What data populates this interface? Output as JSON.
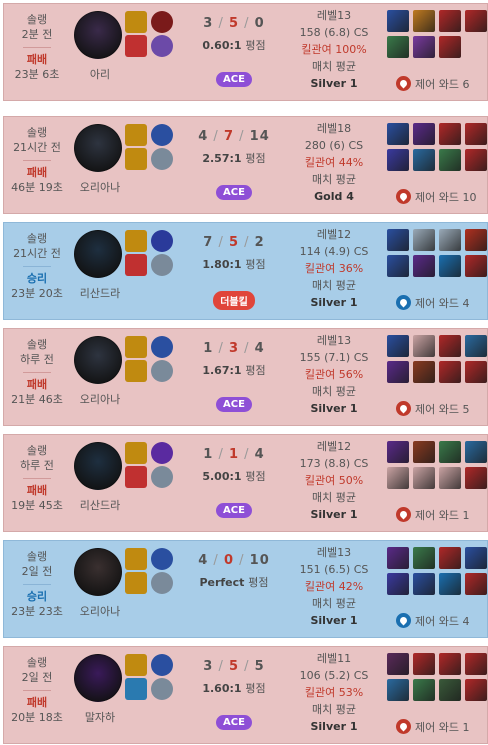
{
  "unit_ratio": "평점",
  "ward_prefix": "제어 와드",
  "cs_suffix": "CS",
  "kp_prefix": "킬관여",
  "avg_label": "매치 평균",
  "level_prefix": "레벨",
  "colors": {
    "loss_bg": "#e8c3c3",
    "win_bg": "#a8cde8",
    "loss_text": "#c0392b",
    "win_text": "#1a6fb0",
    "ace": "#8e4fd6",
    "double_kill": "#e0453a"
  },
  "matches": [
    {
      "queue": "솔랭",
      "ago": "2분 전",
      "result": "패배",
      "duration": "23분 6초",
      "champion": "아리",
      "champ_icon": "ari-portrait-icon",
      "champ_color": "#3a2a4a",
      "spells": [
        "#c08a10",
        "#c03030"
      ],
      "runes": [
        "#7a1a1a",
        "#6c4aa8"
      ],
      "kills": "3",
      "deaths": "5",
      "assists": "0",
      "ratio": "0.60:1",
      "badge": "ACE",
      "badge_type": "ace",
      "level": "레벨13",
      "cs": "158 (6.8) CS",
      "kp": "킬관여 100%",
      "avg": "매치 평균",
      "tier": "Silver 1",
      "items": [
        "#2a4fa0",
        "#c07a20",
        "#b02828",
        "#b02828",
        "#3a7a4a",
        "#7a3aa0",
        "#b02828",
        ""
      ],
      "ward": "제어 와드 6"
    },
    {
      "queue": "솔랭",
      "ago": "21시간 전",
      "result": "패배",
      "duration": "46분 19초",
      "champion": "오리아나",
      "champ_icon": "orianna-portrait-icon",
      "champ_color": "#2e3440",
      "spells": [
        "#c08a10",
        "#c08a10"
      ],
      "runes": [
        "#2a4fa0",
        "#7a8a9a"
      ],
      "kills": "4",
      "deaths": "7",
      "assists": "14",
      "ratio": "2.57:1",
      "badge": "ACE",
      "badge_type": "ace",
      "level": "레벨18",
      "cs": "280 (6) CS",
      "kp": "킬관여 44%",
      "avg": "매치 평균",
      "tier": "Gold 4",
      "items": [
        "#2a4fa0",
        "#5a2a8a",
        "#b02828",
        "#b02828",
        "#3a3aa0",
        "#2a6aa0",
        "#3a7a4a",
        "#b02828"
      ],
      "ward": "제어 와드 10"
    },
    {
      "queue": "솔랭",
      "ago": "21시간 전",
      "result": "승리",
      "duration": "23분 20초",
      "champion": "리산드라",
      "champ_icon": "lissandra-portrait-icon",
      "champ_color": "#1e2f40",
      "spells": [
        "#c08a10",
        "#c03030"
      ],
      "runes": [
        "#2a3a9a",
        "#7a8a9a"
      ],
      "kills": "7",
      "deaths": "5",
      "assists": "2",
      "ratio": "1.80:1",
      "badge": "더블킬",
      "badge_type": "double",
      "level": "레벨12",
      "cs": "114 (4.9) CS",
      "kp": "킬관여 36%",
      "avg": "매치 평균",
      "tier": "Silver 1",
      "items": [
        "#2a4fa0",
        "#9aaab8",
        "#9aaab8",
        "#b03020",
        "#2a4fa0",
        "#5a2a8a",
        "#1a6fb0",
        "#b02828"
      ],
      "ward": "제어 와드 4"
    },
    {
      "queue": "솔랭",
      "ago": "하루 전",
      "result": "패배",
      "duration": "21분 46초",
      "champion": "오리아나",
      "champ_icon": "orianna-portrait-icon",
      "champ_color": "#2e3440",
      "spells": [
        "#c08a10",
        "#c08a10"
      ],
      "runes": [
        "#2a4fa0",
        "#7a8a9a"
      ],
      "kills": "1",
      "deaths": "3",
      "assists": "4",
      "ratio": "1.67:1",
      "badge": "ACE",
      "badge_type": "ace",
      "level": "레벨13",
      "cs": "155 (7.1) CS",
      "kp": "킬관여 56%",
      "avg": "매치 평균",
      "tier": "Silver 1",
      "items": [
        "#2a4fa0",
        "#c9a3a3",
        "#b02828",
        "#2a6aa0",
        "#5a2a8a",
        "#8a3a20",
        "#b02828",
        "#b02828"
      ],
      "ward": "제어 와드 5"
    },
    {
      "queue": "솔랭",
      "ago": "하루 전",
      "result": "패배",
      "duration": "19분 45초",
      "champion": "리산드라",
      "champ_icon": "lissandra-portrait-icon",
      "champ_color": "#1e2f40",
      "spells": [
        "#c08a10",
        "#c03030"
      ],
      "runes": [
        "#5a2aa0",
        "#7a8a9a"
      ],
      "kills": "1",
      "deaths": "1",
      "assists": "4",
      "ratio": "5.00:1",
      "badge": "ACE",
      "badge_type": "ace",
      "level": "레벨12",
      "cs": "173 (8.8) CS",
      "kp": "킬관여 50%",
      "avg": "매치 평균",
      "tier": "Silver 1",
      "items": [
        "#5a2a8a",
        "#8a3a20",
        "#3a7a4a",
        "#2a6aa0",
        "#c9a3a3",
        "#c9a3a3",
        "#c9a3a3",
        "#b02828"
      ],
      "ward": "제어 와드 1"
    },
    {
      "queue": "솔랭",
      "ago": "2일 전",
      "result": "승리",
      "duration": "23분 23초",
      "champion": "오리아나",
      "champ_icon": "orianna-portrait-icon",
      "champ_color": "#3a3030",
      "spells": [
        "#c08a10",
        "#c08a10"
      ],
      "runes": [
        "#2a4fa0",
        "#7a8a9a"
      ],
      "kills": "4",
      "deaths": "0",
      "assists": "10",
      "ratio": "Perfect",
      "badge": "",
      "badge_type": "none",
      "level": "레벨13",
      "cs": "151 (6.5) CS",
      "kp": "킬관여 42%",
      "avg": "매치 평균",
      "tier": "Silver 1",
      "items": [
        "#5a2a8a",
        "#3a7a4a",
        "#b02828",
        "#2a4fa0",
        "#3a3aa0",
        "#2a4fa0",
        "#1a6fb0",
        "#b02828"
      ],
      "ward": "제어 와드 4"
    },
    {
      "queue": "솔랭",
      "ago": "2일 전",
      "result": "패배",
      "duration": "20분 18초",
      "champion": "말자하",
      "champ_icon": "malzahar-portrait-icon",
      "champ_color": "#3a1a5a",
      "spells": [
        "#c08a10",
        "#2a7ab0"
      ],
      "runes": [
        "#2a4fa0",
        "#7a8a9a"
      ],
      "kills": "3",
      "deaths": "5",
      "assists": "5",
      "ratio": "1.60:1",
      "badge": "ACE",
      "badge_type": "ace",
      "level": "레벨11",
      "cs": "106 (5.2) CS",
      "kp": "킬관여 53%",
      "avg": "매치 평균",
      "tier": "Silver 1",
      "items": [
        "#5a2a5a",
        "#b02828",
        "#b02828",
        "#b02828",
        "#2a6aa0",
        "#3a7a4a",
        "#3a5a3a",
        "#b02828"
      ],
      "ward": "제어 와드 1"
    }
  ]
}
